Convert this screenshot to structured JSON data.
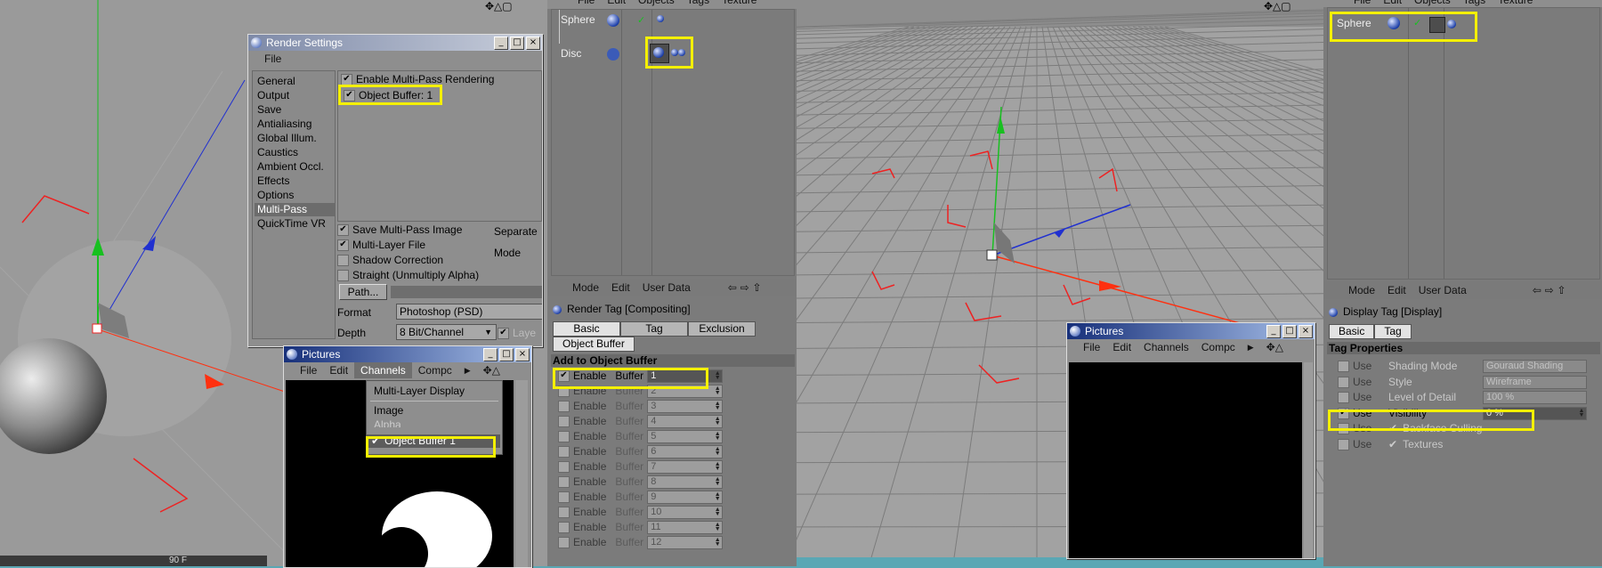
{
  "left_viewport": {
    "time_readout": "90 F"
  },
  "render_settings": {
    "title": "Render Settings",
    "menu": [
      "File"
    ],
    "categories": [
      "General",
      "Output",
      "Save",
      "Antialiasing",
      "Global Illum.",
      "Caustics",
      "Ambient Occl.",
      "Effects",
      "Options",
      "Multi-Pass",
      "QuickTime VR"
    ],
    "selected_category": "Multi-Pass",
    "enable_multipass": "Enable Multi-Pass Rendering",
    "object_buffer_item": "Object Buffer: 1",
    "save_multipass": "Save Multi-Pass Image",
    "multilayer_file": "Multi-Layer File",
    "shadow_correction": "Shadow Correction",
    "straight_alpha": "Straight (Unmultiply Alpha)",
    "separate_label": "Separate",
    "mode_label": "Mode",
    "path_button": "Path...",
    "format_label": "Format",
    "format_value": "Photoshop (PSD)",
    "depth_label": "Depth",
    "depth_value": "8 Bit/Channel",
    "layer_label": "Laye"
  },
  "pictures_left": {
    "title": "Pictures",
    "menu": [
      "File",
      "Edit",
      "Channels",
      "Compc"
    ],
    "dropdown": {
      "items": [
        "Multi-Layer Display",
        "Image",
        "Alpha",
        "Object Buffer 1"
      ],
      "checked_item": "Object Buffer 1"
    }
  },
  "object_manager_mid": {
    "menu": [
      "File",
      "Edit",
      "Objects",
      "Tags",
      "Texture"
    ],
    "objects": [
      {
        "name": "Sphere"
      },
      {
        "name": "Disc"
      }
    ]
  },
  "attributes_mid": {
    "menu": [
      "Mode",
      "Edit",
      "User Data"
    ],
    "title": "Render Tag [Compositing]",
    "tabs": [
      "Basic",
      "Tag",
      "Exclusion"
    ],
    "subtab": "Object Buffer",
    "section": "Add to Object Buffer",
    "enable_label": "Enable",
    "buffer_label": "Buffer",
    "buffers": [
      "1",
      "2",
      "3",
      "4",
      "5",
      "6",
      "7",
      "8",
      "9",
      "10",
      "11",
      "12"
    ]
  },
  "pictures_right": {
    "title": "Pictures",
    "menu": [
      "File",
      "Edit",
      "Channels",
      "Compc"
    ]
  },
  "object_manager_right": {
    "menu": [
      "File",
      "Edit",
      "Objects",
      "Tags",
      "Texture"
    ],
    "objects": [
      {
        "name": "Sphere"
      }
    ]
  },
  "attributes_right": {
    "menu": [
      "Mode",
      "Edit",
      "User Data"
    ],
    "title": "Display Tag [Display]",
    "tabs": [
      "Basic",
      "Tag"
    ],
    "section": "Tag Properties",
    "use_label": "Use",
    "props": [
      {
        "label": "Shading Mode",
        "value": "Gouraud Shading"
      },
      {
        "label": "Style",
        "value": "Wireframe"
      },
      {
        "label": "Level of Detail",
        "value": "100 %"
      },
      {
        "label": "Visibility",
        "value": "0 %"
      },
      {
        "label": "Backface Culling",
        "value": ""
      },
      {
        "label": "Textures",
        "value": ""
      }
    ]
  },
  "colors": {
    "highlight": "#f4f000",
    "axis_x": "#ff3010",
    "axis_y": "#18c020",
    "axis_z": "#2030d0",
    "viewport_bg": "#9a9a9a"
  }
}
